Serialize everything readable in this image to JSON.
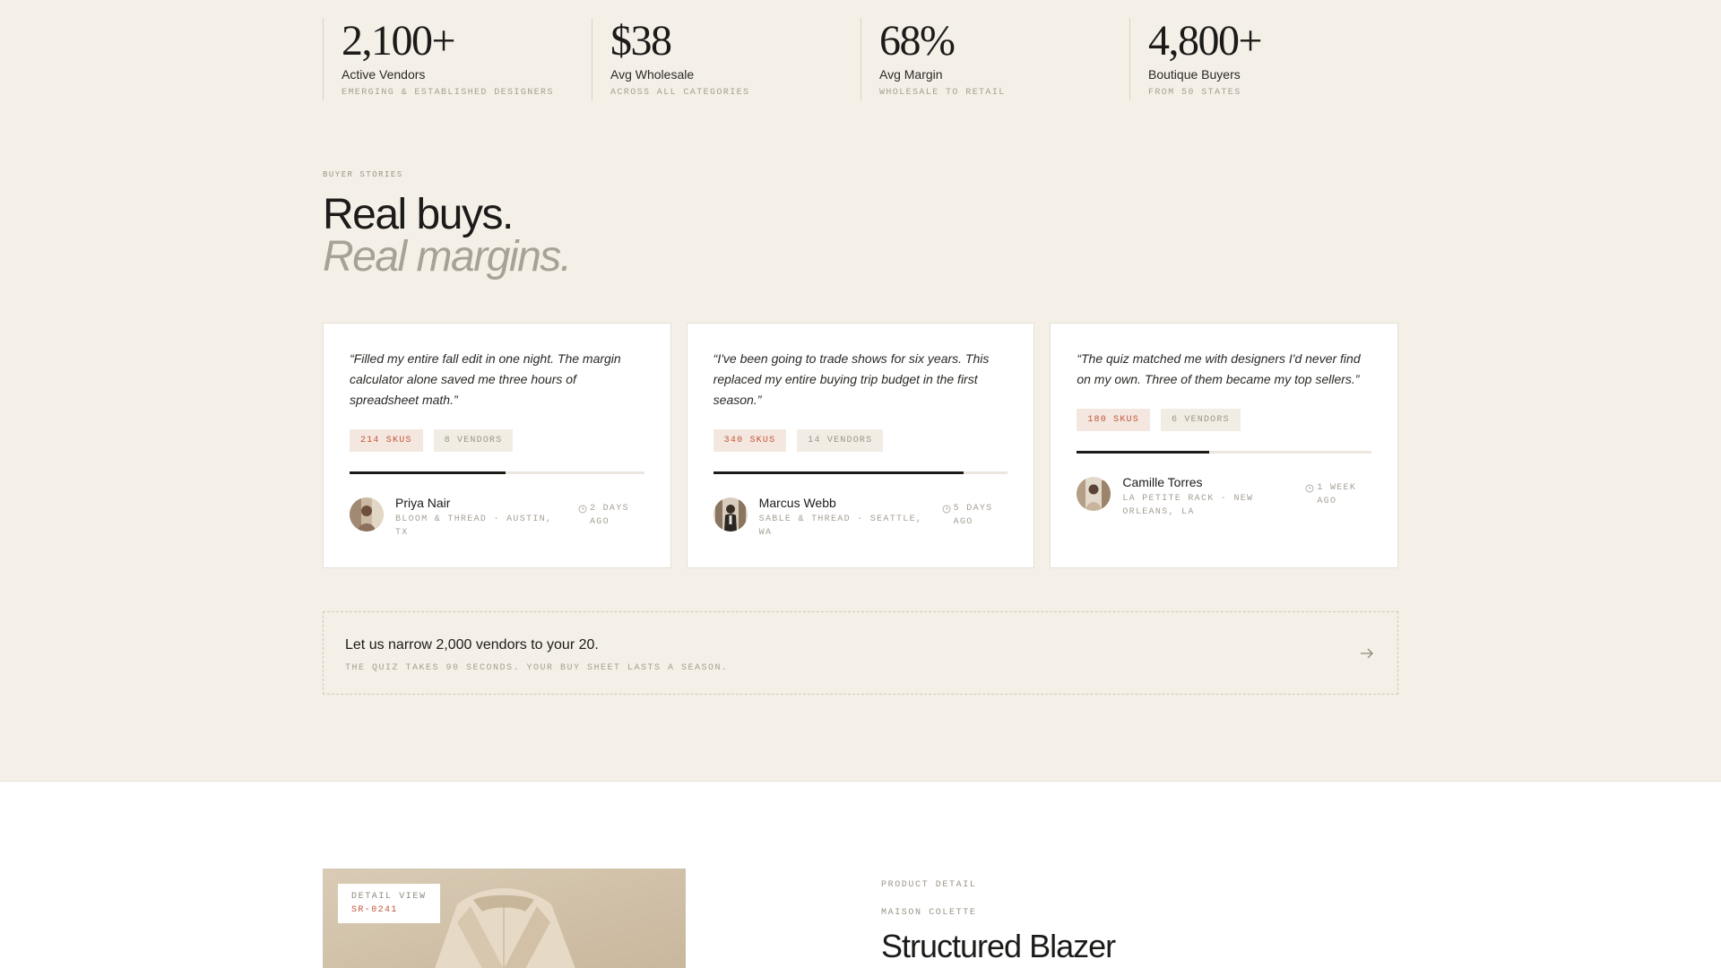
{
  "stats": [
    {
      "value": "2,100+",
      "label": "Active Vendors",
      "sub": "EMERGING & ESTABLISHED DESIGNERS"
    },
    {
      "value": "$38",
      "label": "Avg Wholesale",
      "sub": "ACROSS ALL CATEGORIES"
    },
    {
      "value": "68%",
      "label": "Avg Margin",
      "sub": "WHOLESALE TO RETAIL"
    },
    {
      "value": "4,800+",
      "label": "Boutique Buyers",
      "sub": "FROM 50 STATES"
    }
  ],
  "stories": {
    "eyebrow": "BUYER STORIES",
    "title": "Real buys.",
    "subtitle": "Real margins."
  },
  "cards": [
    {
      "quote": "“Filled my entire fall edit in one night. The margin calculator alone saved me three hours of spreadsheet math.”",
      "skus": "214 SKUS",
      "vendors": "8 VENDORS",
      "progress": 0.53,
      "name": "Priya Nair",
      "location": "BLOOM & THREAD · AUSTIN, TX",
      "time": "2 DAYS AGO",
      "icons": {
        "avatar": "avatar-photo",
        "time": "clock-icon"
      }
    },
    {
      "quote": "“I've been going to trade shows for six years. This replaced my entire buying trip budget in the first season.”",
      "skus": "340 SKUS",
      "vendors": "14 VENDORS",
      "progress": 0.85,
      "name": "Marcus Webb",
      "location": "SABLE & THREAD · SEATTLE, WA",
      "time": "5 DAYS AGO",
      "icons": {
        "avatar": "avatar-photo",
        "time": "clock-icon"
      }
    },
    {
      "quote": "“The quiz matched me with designers I'd never find on my own. Three of them became my top sellers.”",
      "skus": "180 SKUS",
      "vendors": "6 VENDORS",
      "progress": 0.45,
      "name": "Camille Torres",
      "location": "LA PETITE RACK · NEW ORLEANS, LA",
      "time": "1 WEEK AGO",
      "icons": {
        "avatar": "avatar-photo",
        "time": "clock-icon"
      }
    }
  ],
  "cta": {
    "title": "Let us narrow 2,000 vendors to your 20.",
    "subtitle": "THE QUIZ TAKES 90 SECONDS. YOUR BUY SHEET LASTS A SEASON.",
    "icon": "arrow-right-icon"
  },
  "product": {
    "detail_label": "DETAIL VIEW",
    "detail_code": "SR-0241",
    "eyebrow": "PRODUCT DETAIL",
    "brand": "MAISON COLETTE",
    "title": "Structured Blazer"
  },
  "colors": {
    "background": "#f4f0e8",
    "accent": "#c4553b",
    "ink": "#1c1b19",
    "muted": "#a59f94"
  }
}
